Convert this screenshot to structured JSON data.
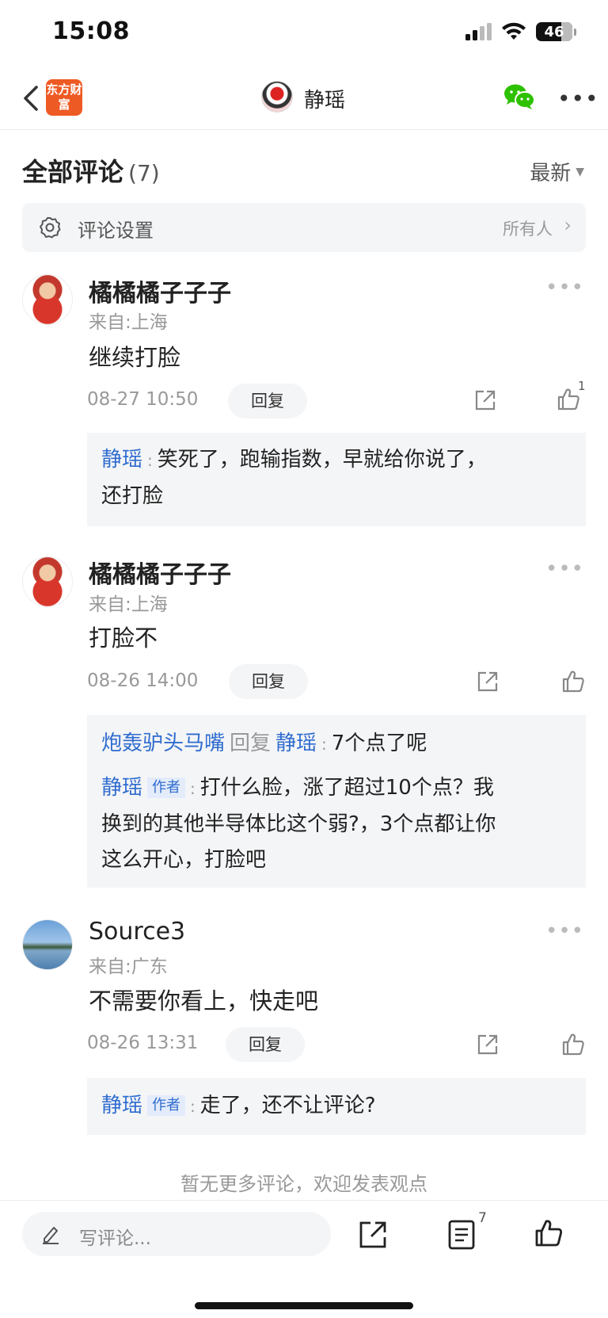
{
  "status_bar": {
    "time": "15:08",
    "battery_level": "46"
  },
  "nav": {
    "app_logo_text": "东方财富",
    "title": "静瑶"
  },
  "header": {
    "title": "全部评论",
    "count": "(7)",
    "sort": "最新"
  },
  "settings": {
    "label": "评论设置",
    "value": "所有人"
  },
  "comments": [
    {
      "username": "橘橘橘子子子",
      "location": "来自:上海",
      "content": "继续打脸",
      "timestamp": "08-27 10:50",
      "reply_label": "回复",
      "likes": "1",
      "replies": [
        {
          "name": "静瑶",
          "text_1": "笑死了，跑输指数，早就给你说了，",
          "text_2": "还打脸"
        }
      ]
    },
    {
      "username": "橘橘橘子子子",
      "location": "来自:上海",
      "content": "打脸不",
      "timestamp": "08-26 14:00",
      "reply_label": "回复",
      "replies": [
        {
          "name": "炮轰驴头马嘴",
          "reply_word": "回复",
          "target": "静瑶",
          "text": "7个点了呢"
        },
        {
          "name": "静瑶",
          "tag": "作者",
          "text_1": "打什么脸，涨了超过10个点？我",
          "text_2": "换到的其他半导体比这个弱?，3个点都让你",
          "text_3": "这么开心，打脸吧"
        }
      ]
    },
    {
      "username": "Source3",
      "location": "来自:广东",
      "content": "不需要你看上，快走吧",
      "timestamp": "08-26 13:31",
      "reply_label": "回复",
      "replies": [
        {
          "name": "静瑶",
          "tag": "作者",
          "text": "走了，还不让评论?"
        }
      ]
    }
  ],
  "end_text": "暂无更多评论，欢迎发表观点",
  "bottom_bar": {
    "placeholder": "写评论...",
    "list_count": "7"
  },
  "colors": {
    "link_blue": "#2f6ccf",
    "logo_orange": "#ee5a24",
    "wechat_green": "#2dc100"
  }
}
